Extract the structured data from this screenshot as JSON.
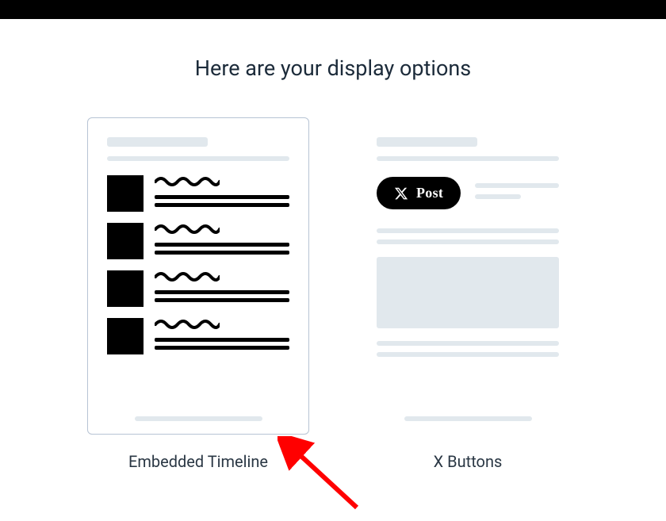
{
  "heading": "Here are your display options",
  "options": {
    "timeline": {
      "label": "Embedded Timeline"
    },
    "buttons": {
      "label": "X Buttons",
      "post_button_text": "Post"
    }
  }
}
